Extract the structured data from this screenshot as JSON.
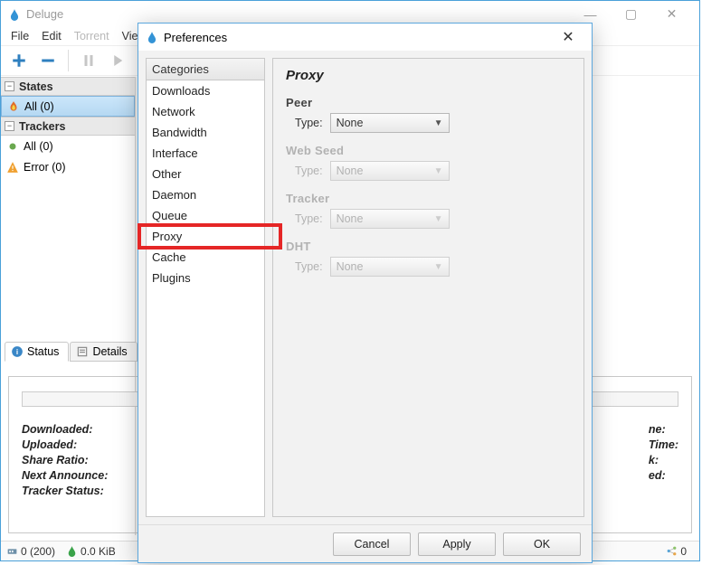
{
  "window": {
    "title": "Deluge",
    "menus": [
      "File",
      "Edit",
      "Torrent",
      "View"
    ],
    "menu_disabled_index": 2
  },
  "sidebar": {
    "groups": [
      {
        "label": "States",
        "items": [
          {
            "label": "All (0)",
            "selected": true,
            "icon": "flame"
          }
        ]
      },
      {
        "label": "Trackers",
        "items": [
          {
            "label": "All (0)",
            "selected": false,
            "icon": "circle"
          },
          {
            "label": "Error (0)",
            "selected": false,
            "icon": "warn"
          }
        ]
      }
    ]
  },
  "bottom_tabs": {
    "status": "Status",
    "details": "Details"
  },
  "details": {
    "left": [
      "Downloaded:",
      "Uploaded:",
      "Share Ratio:",
      "Next Announce:",
      "Tracker Status:"
    ],
    "right": [
      "ne:",
      "Time:",
      "k:",
      "ed:"
    ]
  },
  "statusbar": {
    "conn": "0 (200)",
    "down": "0.0 KiB",
    "net": "0"
  },
  "prefs": {
    "title": "Preferences",
    "categories_header": "Categories",
    "categories": [
      "Downloads",
      "Network",
      "Bandwidth",
      "Interface",
      "Other",
      "Daemon",
      "Queue",
      "Proxy",
      "Cache",
      "Plugins"
    ],
    "highlighted_index": 7,
    "panel_title": "Proxy",
    "groups": [
      {
        "title": "Peer",
        "enabled": true,
        "type_label": "Type:",
        "value": "None"
      },
      {
        "title": "Web Seed",
        "enabled": false,
        "type_label": "Type:",
        "value": "None"
      },
      {
        "title": "Tracker",
        "enabled": false,
        "type_label": "Type:",
        "value": "None"
      },
      {
        "title": "DHT",
        "enabled": false,
        "type_label": "Type:",
        "value": "None"
      }
    ],
    "buttons": {
      "cancel": "Cancel",
      "apply": "Apply",
      "ok": "OK"
    }
  }
}
